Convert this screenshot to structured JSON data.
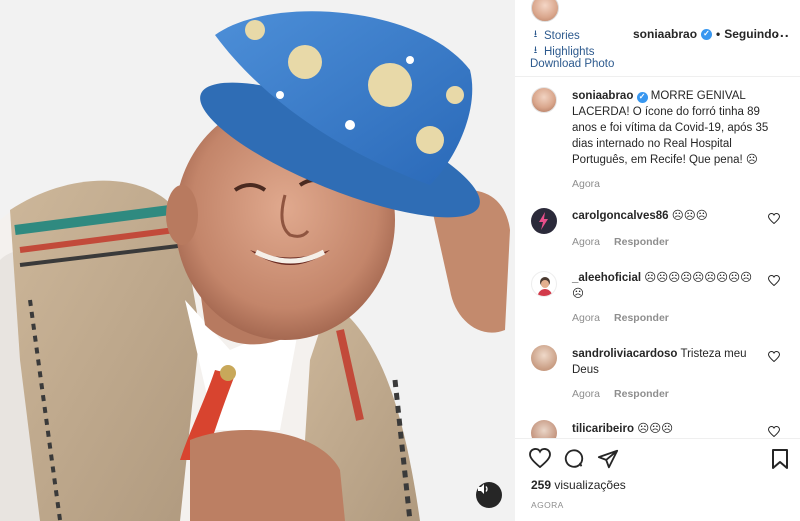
{
  "panel": {
    "menu": {
      "stories": "Stories",
      "highlights": "Highlights",
      "download": "Download Photo"
    },
    "header": {
      "username": "soniaabrao",
      "separator": "•",
      "follow_label": "Seguindo",
      "more_label": "..."
    },
    "caption": {
      "username": "soniaabrao",
      "text": "MORRE GENIVAL LACERDA! O ícone do forró tinha 89 anos e foi vítima da Covid-19, após 35 dias internado no Real Hospital Português, em Recife! Que pena! ☹",
      "time": "Agora"
    },
    "comments": [
      {
        "username": "carolgoncalves86",
        "text": "☹☹☹",
        "time": "Agora",
        "reply": "Responder"
      },
      {
        "username": "_aleehoficial",
        "text": "☹☹☹☹☹☹☹☹☹ ☹",
        "time": "Agora",
        "reply": "Responder"
      },
      {
        "username": "sandroliviacardoso",
        "text": "Tristeza meu Deus",
        "time": "Agora",
        "reply": "Responder"
      },
      {
        "username": "tilicaribeiro",
        "text": "☹☹☹",
        "time": "",
        "reply": ""
      }
    ],
    "footer": {
      "views_count": "259",
      "views_label": "visualizações",
      "post_time": "AGORA"
    }
  },
  "icons": {
    "heart": "heart-icon",
    "comment": "comment-icon",
    "share": "share-icon",
    "bookmark": "bookmark-icon",
    "mute": "speaker-icon"
  },
  "colors": {
    "link": "#2d5a8e",
    "verified": "#3897f0",
    "muted_text": "#8e8e8e"
  }
}
